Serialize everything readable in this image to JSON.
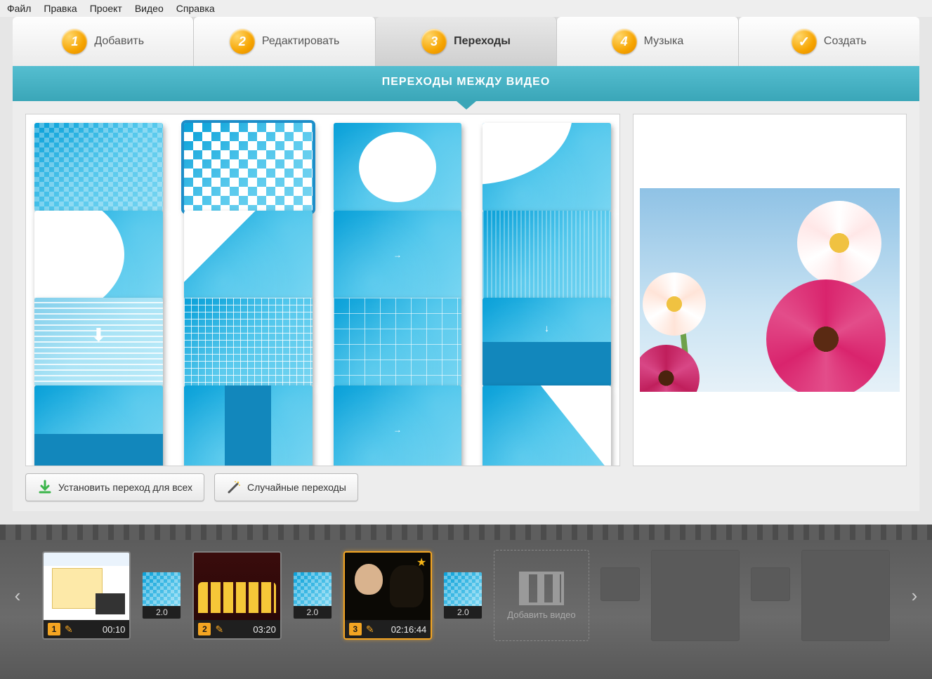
{
  "menu": {
    "file": "Файл",
    "edit": "Правка",
    "project": "Проект",
    "video": "Видео",
    "help": "Справка"
  },
  "steps": [
    {
      "num": "1",
      "label": "Добавить"
    },
    {
      "num": "2",
      "label": "Редактировать"
    },
    {
      "num": "3",
      "label": "Переходы",
      "active": true
    },
    {
      "num": "4",
      "label": "Музыка"
    },
    {
      "check": "✓",
      "label": "Создать"
    }
  ],
  "banner_title": "ПЕРЕХОДЫ МЕЖДУ ВИДЕО",
  "transitions": [
    {
      "style": "checkerlight",
      "selected": false
    },
    {
      "style": "checker",
      "selected": true
    },
    {
      "style": "circle",
      "selected": false
    },
    {
      "style": "wedge-tl",
      "selected": false
    },
    {
      "style": "wedge-bl",
      "selected": false
    },
    {
      "style": "diag",
      "selected": false
    },
    {
      "style": "center-arrow",
      "selected": false
    },
    {
      "style": "vstripes",
      "selected": false
    },
    {
      "style": "hlines-blur",
      "selected": false
    },
    {
      "style": "finegrid",
      "selected": false
    },
    {
      "style": "biggrid",
      "selected": false
    },
    {
      "style": "halfdown",
      "selected": false
    },
    {
      "style": "halfup",
      "selected": false
    },
    {
      "style": "vcenter",
      "selected": false
    },
    {
      "style": "center-arrow",
      "selected": false
    },
    {
      "style": "triangle",
      "selected": false
    }
  ],
  "buttons": {
    "apply_all": "Установить переход для всех",
    "random": "Случайные переходы"
  },
  "timeline": {
    "add_label": "Добавить видео",
    "clips": [
      {
        "num": "1",
        "duration": "00:10",
        "thumb": "desktop",
        "selected": false
      },
      {
        "num": "2",
        "duration": "03:20",
        "thumb": "minions",
        "selected": false
      },
      {
        "num": "3",
        "duration": "02:16:44",
        "thumb": "movie",
        "selected": true,
        "starred": true
      }
    ],
    "trans_duration": "2.0"
  }
}
